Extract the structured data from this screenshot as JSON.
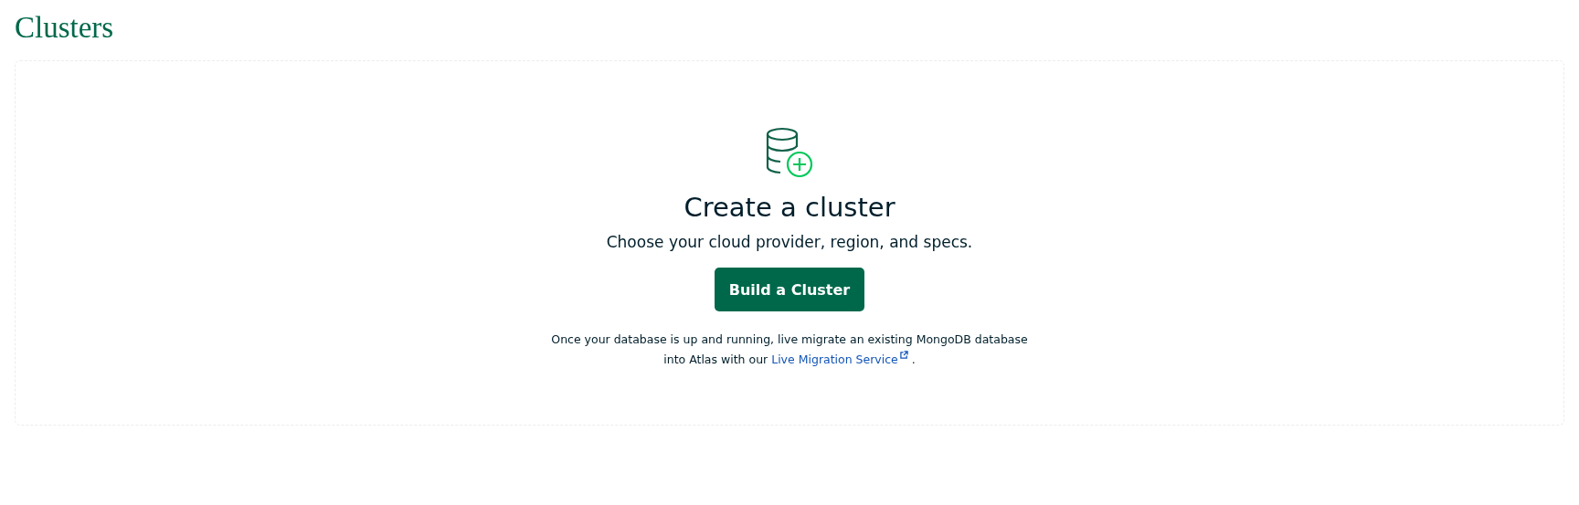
{
  "page_title": "Clusters",
  "empty_state": {
    "heading": "Create a cluster",
    "subtitle": "Choose your cloud provider, region, and specs.",
    "button": "Build a Cluster",
    "note": {
      "text_before": "Once your database is up and running, live migrate an existing MongoDB database into Atlas with our ",
      "link": "Live Migration Service",
      "text_after": " ."
    }
  }
}
